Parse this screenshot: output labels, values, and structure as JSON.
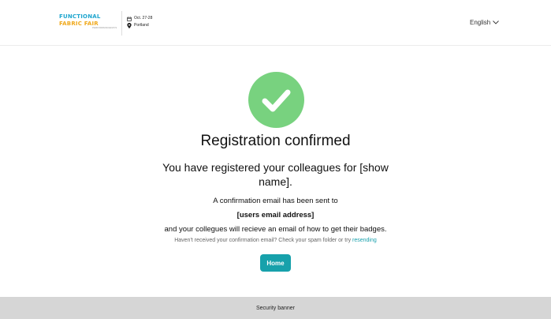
{
  "header": {
    "logo": {
      "line1": "FUNCTIONAL",
      "line2": "FABRIC FAIR",
      "line3": "PERFORMANCEDAYS"
    },
    "event": {
      "date": "Oct. 27-28",
      "location": "Portland",
      "calendar_icon": "calendar-icon",
      "location_icon": "map-pin-icon"
    },
    "language": {
      "label": "English",
      "icon": "chevron-down-icon"
    }
  },
  "confirmation": {
    "icon": "check-circle-icon",
    "icon_color": "#78d27f",
    "title": "Registration confirmed",
    "subtitle": "You have registered your colleagues for [show name].",
    "sent_line": "A confirmation email has been sent to",
    "email": "[users email address]",
    "badges_line": "and your collegues will recieve an email of how to get their badges.",
    "help_text": "Haven't received your confirmation email? Check your spam folder or try",
    "resend_link": "resending",
    "link_color": "#1aa1ad"
  },
  "actions": {
    "home_label": "Home",
    "home_color": "#17a1ab"
  },
  "footer": {
    "security_banner": "Security banner"
  }
}
